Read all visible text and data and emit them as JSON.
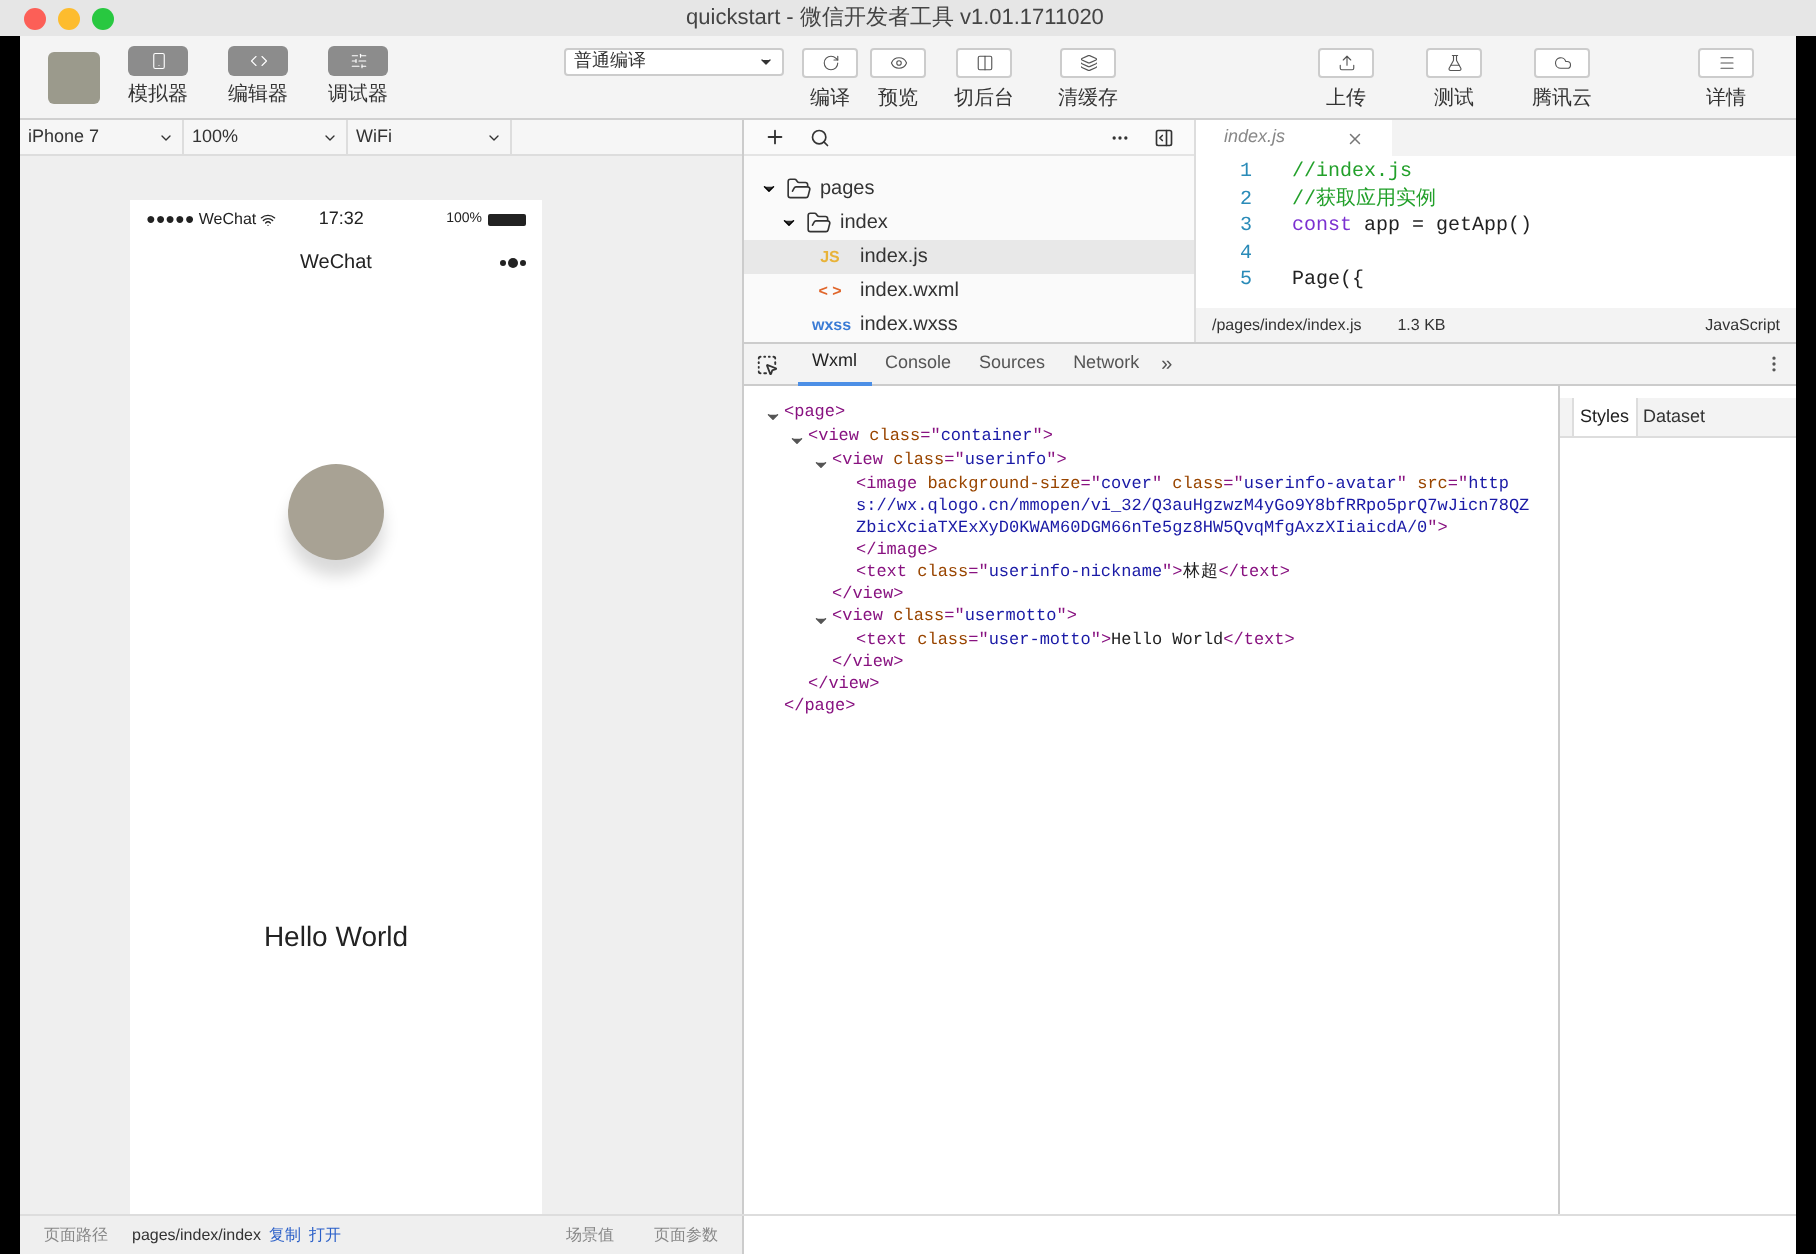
{
  "window": {
    "title": "quickstart - 微信开发者工具 v1.01.1711020"
  },
  "toolbar": {
    "modes": [
      {
        "label": "模拟器"
      },
      {
        "label": "编辑器"
      },
      {
        "label": "调试器"
      }
    ],
    "compile_select": "普通编译",
    "actions": [
      {
        "label": "编译"
      },
      {
        "label": "预览"
      },
      {
        "label": "切后台"
      },
      {
        "label": "清缓存"
      }
    ],
    "right_actions": [
      {
        "label": "上传"
      },
      {
        "label": "测试"
      },
      {
        "label": "腾讯云"
      },
      {
        "label": "详情"
      }
    ]
  },
  "simulator": {
    "selects": [
      "iPhone 7",
      "100%",
      "WiFi"
    ],
    "carrier": "●●●●● WeChat",
    "time": "17:32",
    "battery": "100%",
    "nav_title": "WeChat",
    "motto": "Hello World"
  },
  "file_tree": [
    {
      "name": "pages",
      "expanded": true,
      "children": [
        {
          "name": "index",
          "expanded": true,
          "children": [
            {
              "name": "index.js",
              "badge": "JS",
              "color": "#e8b339",
              "selected": true
            },
            {
              "name": "index.wxml",
              "badge": "< >",
              "color": "#e0662b",
              "selected": false
            },
            {
              "name": "index.wxss",
              "badge": "wxss",
              "color": "#3a7bd5",
              "selected": false
            }
          ]
        }
      ]
    }
  ],
  "editor": {
    "tab": "index.js",
    "lines": [
      {
        "number": "1",
        "tokens": [
          {
            "kind": "comment",
            "text": "//index.js"
          }
        ]
      },
      {
        "number": "2",
        "tokens": [
          {
            "kind": "comment",
            "text": "//获取应用实例"
          }
        ]
      },
      {
        "number": "3",
        "tokens": [
          {
            "kind": "keyword",
            "text": "const"
          },
          {
            "kind": "plain",
            "text": " app = getApp()"
          }
        ]
      },
      {
        "number": "4"
      },
      {
        "number": "5",
        "tokens": [
          {
            "kind": "plain",
            "text": "Page({"
          }
        ]
      }
    ],
    "path": "/pages/index/index.js",
    "size": "1.3 KB",
    "language": "JavaScript"
  },
  "devtools": {
    "tabs": [
      {
        "label": "Wxml",
        "selected": true
      },
      {
        "label": "Console",
        "selected": false
      },
      {
        "label": "Sources",
        "selected": false
      },
      {
        "label": "Network",
        "selected": false
      }
    ],
    "more": "»",
    "side_tabs": [
      {
        "label": "Styles",
        "selected": true
      },
      {
        "label": "Dataset",
        "selected": false
      }
    ],
    "wxml": [
      {
        "kind": "block",
        "expanded": true,
        "open": [
          {
            "kind": "tag",
            "text": "<page>"
          }
        ],
        "close": [
          {
            "kind": "tag",
            "text": "</page>"
          }
        ],
        "children": [
          {
            "kind": "block",
            "expanded": true,
            "open": [
              {
                "kind": "tag",
                "text": "<view"
              },
              {
                "kind": "attr",
                "text": " class"
              },
              {
                "kind": "punct",
                "text": "=\""
              },
              {
                "kind": "value",
                "text": "container"
              },
              {
                "kind": "punct",
                "text": "\">"
              }
            ],
            "close": [
              {
                "kind": "tag",
                "text": "</view>"
              }
            ],
            "children": [
              {
                "kind": "block",
                "expanded": true,
                "open": [
                  {
                    "kind": "tag",
                    "text": "<view"
                  },
                  {
                    "kind": "attr",
                    "text": " class"
                  },
                  {
                    "kind": "punct",
                    "text": "=\""
                  },
                  {
                    "kind": "value",
                    "text": "userinfo"
                  },
                  {
                    "kind": "punct",
                    "text": "\">"
                  }
                ],
                "close": [
                  {
                    "kind": "tag",
                    "text": "</view>"
                  }
                ],
                "children": [
                  {
                    "kind": "leaf",
                    "open": [
                      {
                        "kind": "tag",
                        "text": "<image"
                      },
                      {
                        "kind": "attr",
                        "text": " background-size"
                      },
                      {
                        "kind": "punct",
                        "text": "=\""
                      },
                      {
                        "kind": "value",
                        "text": "cover"
                      },
                      {
                        "kind": "punct",
                        "text": "\""
                      },
                      {
                        "kind": "attr",
                        "text": " class"
                      },
                      {
                        "kind": "punct",
                        "text": "=\""
                      },
                      {
                        "kind": "value",
                        "text": "userinfo-avatar"
                      },
                      {
                        "kind": "punct",
                        "text": "\""
                      },
                      {
                        "kind": "attr",
                        "text": " src"
                      },
                      {
                        "kind": "punct",
                        "text": "=\""
                      },
                      {
                        "kind": "value",
                        "text": "https://wx.qlogo.cn/mmopen/vi_32/Q3auHgzwzM4yGo9Y8bfRRpo5prQ7wJicn78QZZbicXciaTXExXyD0KWAM60DGM66nTe5gz8HW5QvqMfgAxzXIiaicdA/0"
                      },
                      {
                        "kind": "punct",
                        "text": "\">"
                      }
                    ],
                    "close": [
                      {
                        "kind": "tag",
                        "text": "</image>"
                      }
                    ]
                  },
                  {
                    "kind": "inline",
                    "open": [
                      {
                        "kind": "tag",
                        "text": "<text"
                      },
                      {
                        "kind": "attr",
                        "text": " class"
                      },
                      {
                        "kind": "punct",
                        "text": "=\""
                      },
                      {
                        "kind": "value",
                        "text": "userinfo-nickname"
                      },
                      {
                        "kind": "punct",
                        "text": "\">"
                      },
                      {
                        "kind": "plain",
                        "text": "林超"
                      },
                      {
                        "kind": "tag",
                        "text": "</text>"
                      }
                    ]
                  }
                ]
              },
              {
                "kind": "block",
                "expanded": true,
                "open": [
                  {
                    "kind": "tag",
                    "text": "<view"
                  },
                  {
                    "kind": "attr",
                    "text": " class"
                  },
                  {
                    "kind": "punct",
                    "text": "=\""
                  },
                  {
                    "kind": "value",
                    "text": "usermotto"
                  },
                  {
                    "kind": "punct",
                    "text": "\">"
                  }
                ],
                "close": [
                  {
                    "kind": "tag",
                    "text": "</view>"
                  }
                ],
                "children": [
                  {
                    "kind": "inline",
                    "open": [
                      {
                        "kind": "tag",
                        "text": "<text"
                      },
                      {
                        "kind": "attr",
                        "text": " class"
                      },
                      {
                        "kind": "punct",
                        "text": "=\""
                      },
                      {
                        "kind": "value",
                        "text": "user-motto"
                      },
                      {
                        "kind": "punct",
                        "text": "\">"
                      },
                      {
                        "kind": "plain",
                        "text": "Hello World"
                      },
                      {
                        "kind": "tag",
                        "text": "</text>"
                      }
                    ]
                  }
                ]
              }
            ]
          }
        ]
      }
    ]
  },
  "footer": {
    "path_label": "页面路径",
    "path": "pages/index/index",
    "copy": "复制",
    "open": "打开",
    "scene": "场景值",
    "params": "页面参数"
  }
}
